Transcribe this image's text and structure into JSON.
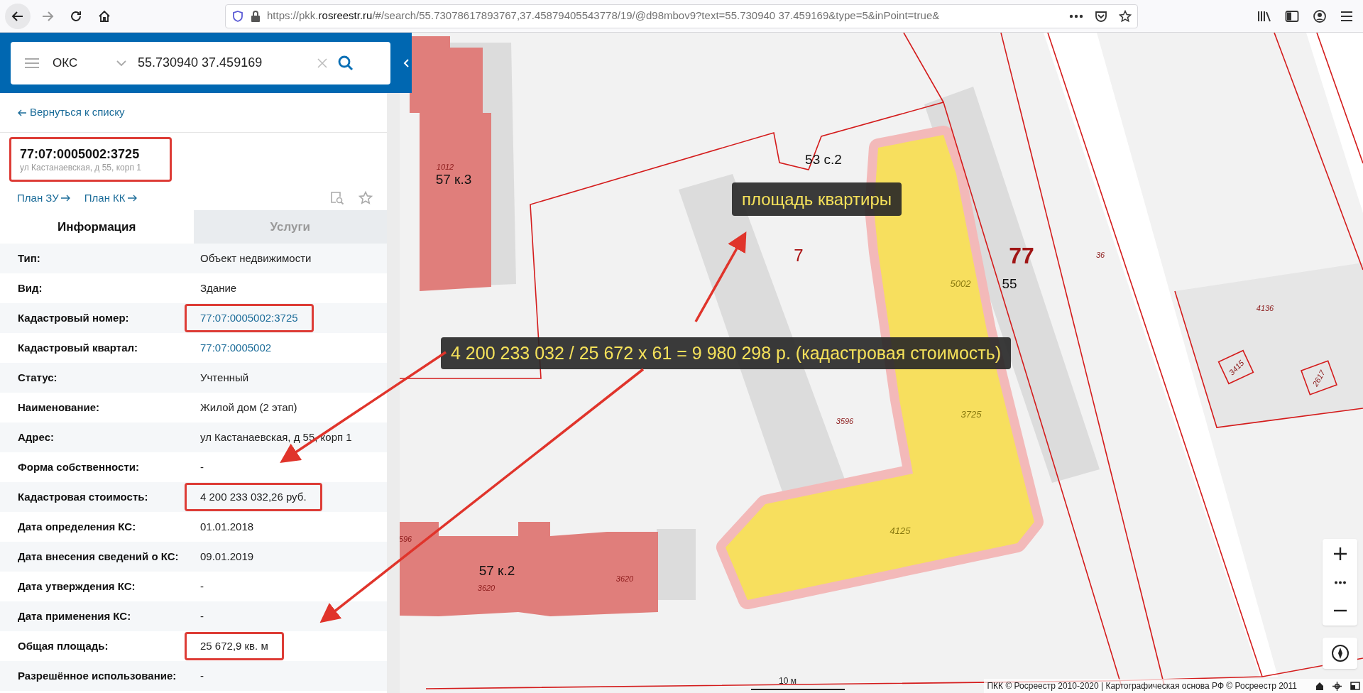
{
  "browser": {
    "url_prefix": "https://pkk.",
    "url_host": "rosreestr.ru",
    "url_rest": "/#/search/55.73078617893767,37.45879405543778/19/@d98mbov9?text=55.730940 37.459169&type=5&inPoint=true&"
  },
  "search": {
    "category": "ОКС",
    "query": "55.730940 37.459169"
  },
  "back_link": "Вернуться к списку",
  "object": {
    "number": "77:07:0005002:3725",
    "address": "ул Кастанаевская, д 55, корп 1",
    "highlighted": true
  },
  "plan_links": [
    "План ЗУ",
    "План КК"
  ],
  "tabs": [
    {
      "label": "Информация",
      "selected": true
    },
    {
      "label": "Услуги",
      "selected": false
    }
  ],
  "fields": [
    {
      "label": "Тип:",
      "value": "Объект недвижимости",
      "kind": "text",
      "highlighted": false
    },
    {
      "label": "Вид:",
      "value": "Здание",
      "kind": "text",
      "highlighted": false
    },
    {
      "label": "Кадастровый номер:",
      "value": "77:07:0005002:3725",
      "kind": "link",
      "highlighted": true
    },
    {
      "label": "Кадастровый квартал:",
      "value": "77:07:0005002",
      "kind": "link",
      "highlighted": false
    },
    {
      "label": "Статус:",
      "value": "Учтенный",
      "kind": "text",
      "highlighted": false
    },
    {
      "label": "Наименование:",
      "value": "Жилой дом (2 этап)",
      "kind": "text",
      "highlighted": false
    },
    {
      "label": "Адрес:",
      "value": "ул Кастанаевская, д 55, корп 1",
      "kind": "text",
      "highlighted": false
    },
    {
      "label": "Форма собственности:",
      "value": "-",
      "kind": "text",
      "highlighted": false
    },
    {
      "label": "Кадастровая стоимость:",
      "value": "4 200 233 032,26 руб.",
      "kind": "text",
      "highlighted": true
    },
    {
      "label": "Дата определения КС:",
      "value": "01.01.2018",
      "kind": "text",
      "highlighted": false
    },
    {
      "label": "Дата внесения сведений о КС:",
      "value": "09.01.2019",
      "kind": "text",
      "highlighted": false
    },
    {
      "label": "Дата утверждения КС:",
      "value": "-",
      "kind": "text",
      "highlighted": false
    },
    {
      "label": "Дата применения КС:",
      "value": "-",
      "kind": "text",
      "highlighted": false
    },
    {
      "label": "Общая площадь:",
      "value": "25 672,9 кв. м",
      "kind": "text",
      "highlighted": true
    },
    {
      "label": "Разрешённое использование:",
      "value": "-",
      "kind": "text",
      "highlighted": false
    }
  ],
  "map": {
    "labels": [
      {
        "text": "53 с.2",
        "kind": "address"
      },
      {
        "text": "1012",
        "kind": "number"
      },
      {
        "text": "57 к.3",
        "kind": "address"
      },
      {
        "text": "7",
        "kind": "block"
      },
      {
        "text": "77",
        "kind": "quarter"
      },
      {
        "text": "36",
        "kind": "number"
      },
      {
        "text": "5002",
        "kind": "parcel"
      },
      {
        "text": "55",
        "kind": "address"
      },
      {
        "text": "4136",
        "kind": "number"
      },
      {
        "text": "3596",
        "kind": "number"
      },
      {
        "text": "3725",
        "kind": "parcel"
      },
      {
        "text": "4125",
        "kind": "parcel"
      },
      {
        "text": "596",
        "kind": "number"
      },
      {
        "text": "57 к.2",
        "kind": "address"
      },
      {
        "text": "3620",
        "kind": "number"
      },
      {
        "text": "3620",
        "kind": "number"
      },
      {
        "text": "3415",
        "kind": "number"
      },
      {
        "text": "2617",
        "kind": "number"
      }
    ],
    "scale": "10 м",
    "attribution": "ПКК © Росреестр 2010-2020 | Картографическая основа РФ © Росреестр 2011"
  },
  "annotations": [
    {
      "text": "площадь квартиры"
    },
    {
      "text": "4 200 233 032 / 25 672 x 61 = 9 980 298 р. (кадастровая стоимость)"
    }
  ]
}
